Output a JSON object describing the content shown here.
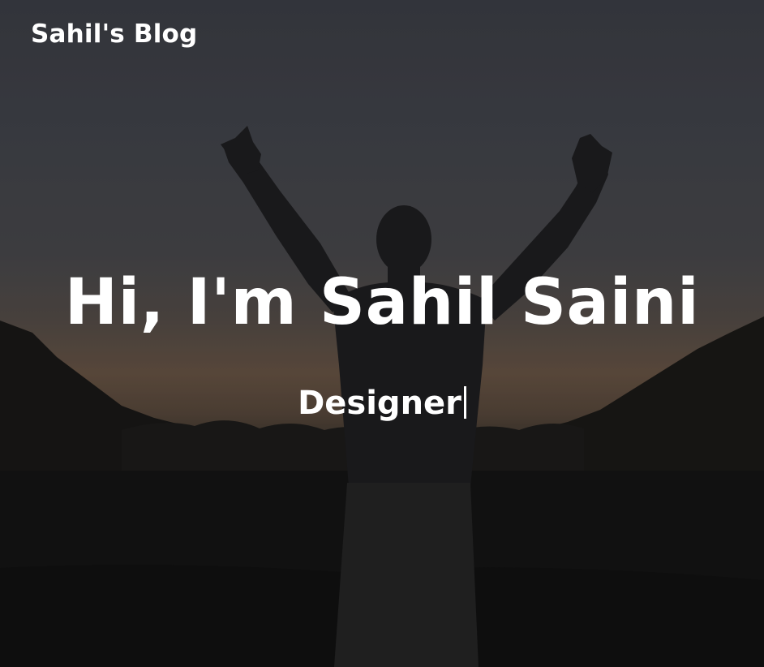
{
  "nav": {
    "brand": "Sahil's Blog"
  },
  "hero": {
    "headline": "Hi, I'm Sahil Saini",
    "role": "Designer",
    "background": "silhouette-photo"
  },
  "colors": {
    "text": "#ffffff",
    "sky_top": "#3e4048",
    "horizon": "#6a5646",
    "ground": "#141414"
  }
}
